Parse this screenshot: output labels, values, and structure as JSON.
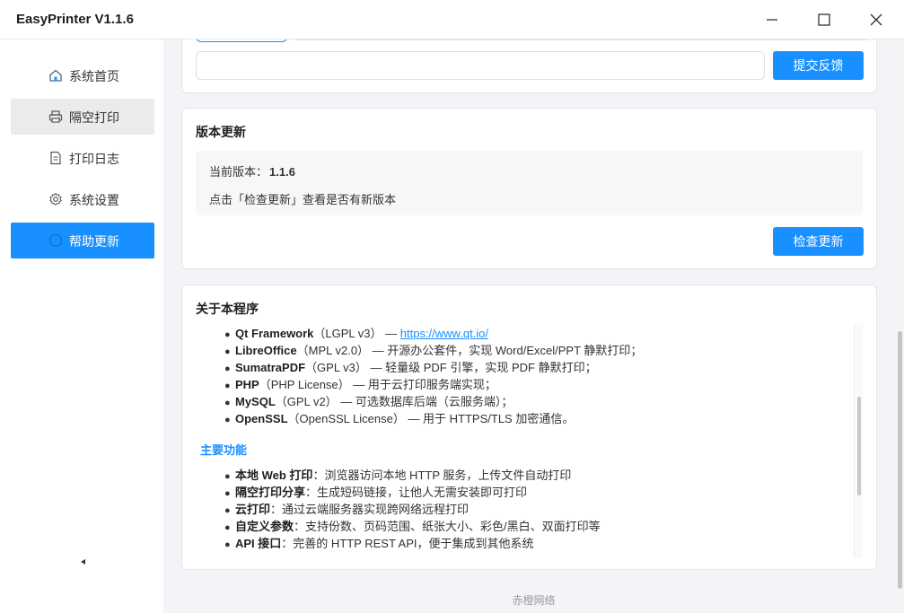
{
  "window": {
    "title": "EasyPrinter  V1.1.6",
    "minimize_glyph": "—",
    "maximize_glyph": "☐",
    "close_glyph": "✕"
  },
  "sidebar": {
    "items": [
      {
        "label": "系统首页",
        "icon": "home-icon"
      },
      {
        "label": "隔空打印",
        "icon": "printer-icon"
      },
      {
        "label": "打印日志",
        "icon": "document-icon"
      },
      {
        "label": "系统设置",
        "icon": "gear-icon"
      },
      {
        "label": "帮助更新",
        "icon": "help-circle-icon"
      }
    ],
    "active_index": 4,
    "hover_index": 1
  },
  "feedback": {
    "input_value": "",
    "input_placeholder": "",
    "submit_label": "提交反馈"
  },
  "version": {
    "title": "版本更新",
    "current_label": "当前版本：",
    "current_value": "1.1.6",
    "hint": "点击「检查更新」查看是否有新版本",
    "check_label": "检查更新"
  },
  "about": {
    "title": "关于本程序",
    "libraries": [
      {
        "name": "Qt Framework",
        "license": "（LGPL v3）",
        "desc": " — ",
        "link": "https://www.qt.io/"
      },
      {
        "name": "LibreOffice",
        "license": "（MPL v2.0）",
        "desc": " — 开源办公套件，实现 Word/Excel/PPT 静默打印；",
        "link": ""
      },
      {
        "name": "SumatraPDF",
        "license": "（GPL v3）",
        "desc": " — 轻量级 PDF 引擎，实现 PDF 静默打印；",
        "link": ""
      },
      {
        "name": "PHP",
        "license": "（PHP License）",
        "desc": " — 用于云打印服务端实现；",
        "link": ""
      },
      {
        "name": "MySQL",
        "license": "（GPL v2）",
        "desc": " — 可选数据库后端（云服务端）；",
        "link": ""
      },
      {
        "name": "OpenSSL",
        "license": "（OpenSSL License）",
        "desc": " — 用于 HTTPS/TLS 加密通信。",
        "link": ""
      }
    ],
    "features_heading": "主要功能",
    "features": [
      {
        "name": "本地 Web 打印",
        "desc": "：浏览器访问本地 HTTP 服务，上传文件自动打印"
      },
      {
        "name": "隔空打印分享",
        "desc": "：生成短码链接，让他人无需安装即可打印"
      },
      {
        "name": "云打印",
        "desc": "：通过云端服务器实现跨网络远程打印"
      },
      {
        "name": "自定义参数",
        "desc": "：支持份数、页码范围、纸张大小、彩色/黑白、双面打印等"
      },
      {
        "name": "API 接口",
        "desc": "：完善的 HTTP REST API，便于集成到其他系统"
      }
    ],
    "bullet": "●"
  },
  "footer": {
    "text": "赤橙网络"
  },
  "colors": {
    "accent": "#1890ff",
    "sidebar_hover": "#ebebeb",
    "background": "#f2f4f7"
  }
}
